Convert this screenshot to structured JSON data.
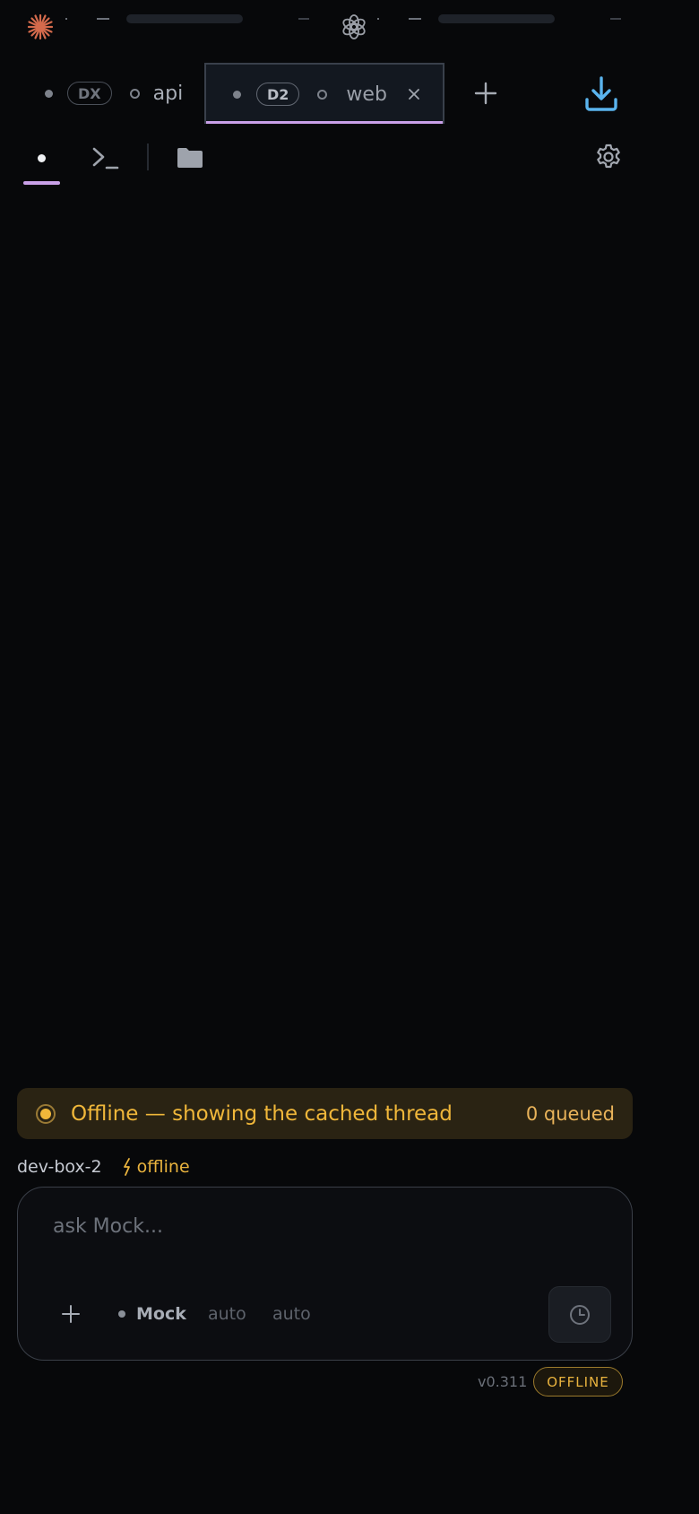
{
  "status_strip": {
    "left_icon": "claude-asterisk-icon",
    "center_icon": "openai-logo-icon"
  },
  "tabs": [
    {
      "badge": "DX",
      "label": "api",
      "active": false
    },
    {
      "badge": "D2",
      "label": "web",
      "active": true,
      "close_icon": "close-icon"
    }
  ],
  "tab_actions": {
    "add_icon": "plus-icon",
    "download_icon": "download-icon"
  },
  "toolbar": {
    "items": [
      "chat-dot-icon",
      "terminal-icon",
      "folder-icon"
    ],
    "settings_icon": "gear-icon"
  },
  "banner": {
    "text": "Offline — showing the cached thread",
    "queued": "0 queued"
  },
  "host": {
    "name": "dev-box-2",
    "status_icon": "lightning-icon",
    "status": "offline"
  },
  "composer": {
    "placeholder": "ask Mock...",
    "add_icon": "plus-icon",
    "model": "Mock",
    "option_1": "auto",
    "option_2": "auto",
    "send_icon": "clock-icon"
  },
  "footer": {
    "version": "v0.311",
    "status_badge": "OFFLINE"
  },
  "colors": {
    "background": "#07080a",
    "accent_purple": "#c9a0e8",
    "warning_amber": "#f0b73a",
    "download_blue": "#5ab4ee",
    "claude_orange": "#d46a4c"
  }
}
